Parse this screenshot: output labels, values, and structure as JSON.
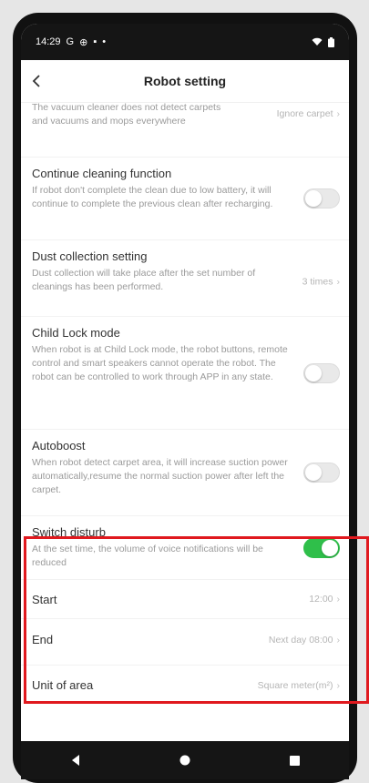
{
  "statusbar": {
    "time": "14:29",
    "icons_left": [
      "G",
      "⊕",
      "▪",
      "•"
    ]
  },
  "header": {
    "title": "Robot setting"
  },
  "settings": [
    {
      "label": "",
      "desc": "The vacuum cleaner does not detect carpets and vacuums and mops everywhere",
      "value": "Ignore carpet"
    },
    {
      "label": "Continue cleaning function",
      "desc": "If robot don't complete the clean due to low battery, it will continue to complete the previous clean after recharging.",
      "toggle": false
    },
    {
      "label": "Dust collection setting",
      "desc": "Dust collection will take place after the set number of cleanings has been performed.",
      "value": "3 times"
    },
    {
      "label": "Child Lock mode",
      "desc": "When robot is at Child Lock mode, the robot buttons, remote control and smart speakers cannot operate the robot. The robot can be controlled to work through APP in any state.",
      "toggle": false
    },
    {
      "label": "Autoboost",
      "desc": "When robot detect carpet area, it will increase suction power automatically,resume the normal suction power after left the carpet.",
      "toggle": false
    },
    {
      "label": "Switch disturb",
      "desc": "At the set time, the volume of voice notifications will be reduced",
      "toggle": true
    },
    {
      "label": "Start",
      "value": "12:00"
    },
    {
      "label": "End",
      "value": "Next day 08:00"
    },
    {
      "label": "Unit of area",
      "value": "Square meter(m²)"
    }
  ],
  "colors": {
    "accent_green": "#2fbf4a",
    "highlight_red": "#e0191e"
  },
  "icons": {
    "back": "chevron-left-icon",
    "wifi": "wifi-icon",
    "battery": "battery-icon",
    "nav_back": "nav-back-icon",
    "nav_home": "nav-home-icon",
    "nav_recents": "nav-recents-icon"
  }
}
